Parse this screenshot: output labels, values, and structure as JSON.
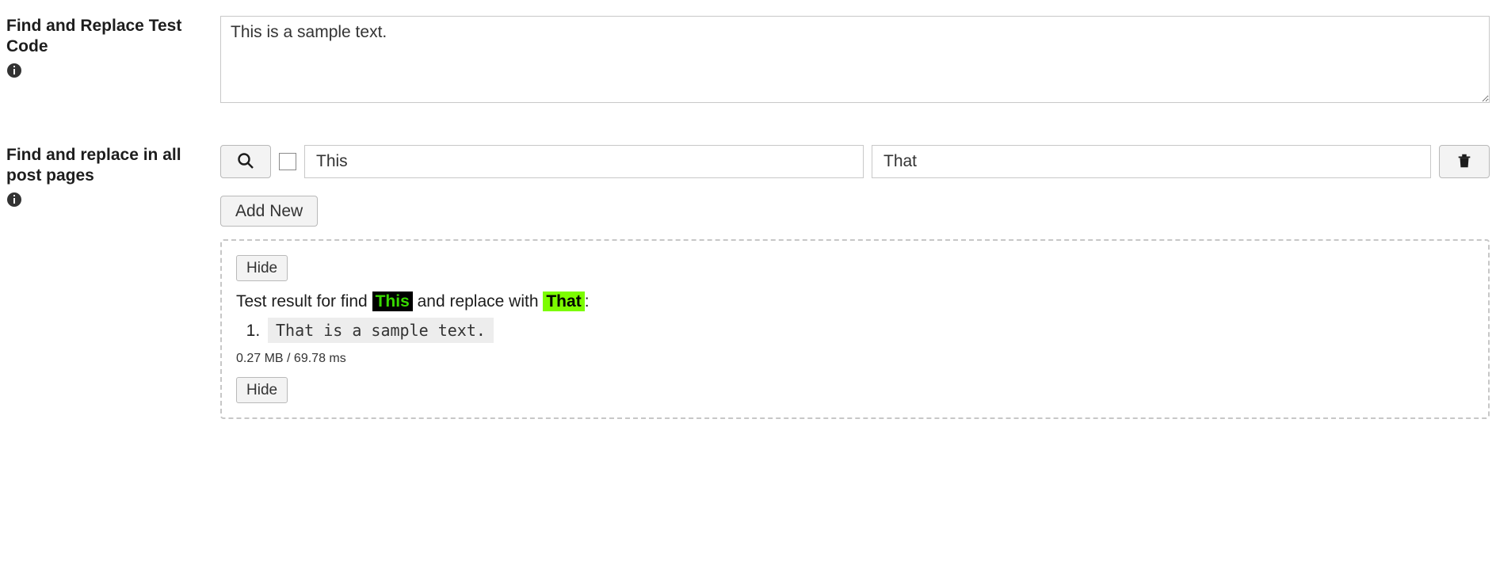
{
  "section1": {
    "title": "Find and Replace Test Code",
    "textarea_value": "This is a sample text."
  },
  "section2": {
    "title": "Find and replace in all post pages",
    "find_value": "This",
    "replace_value": "That",
    "add_new_label": "Add New"
  },
  "result": {
    "hide_label": "Hide",
    "prefix": "Test result for find ",
    "mid": " and replace with ",
    "suffix": ":",
    "find_token": "This",
    "replace_token": "That",
    "items": [
      "That is a sample text."
    ],
    "meta": "0.27 MB / 69.78 ms"
  }
}
